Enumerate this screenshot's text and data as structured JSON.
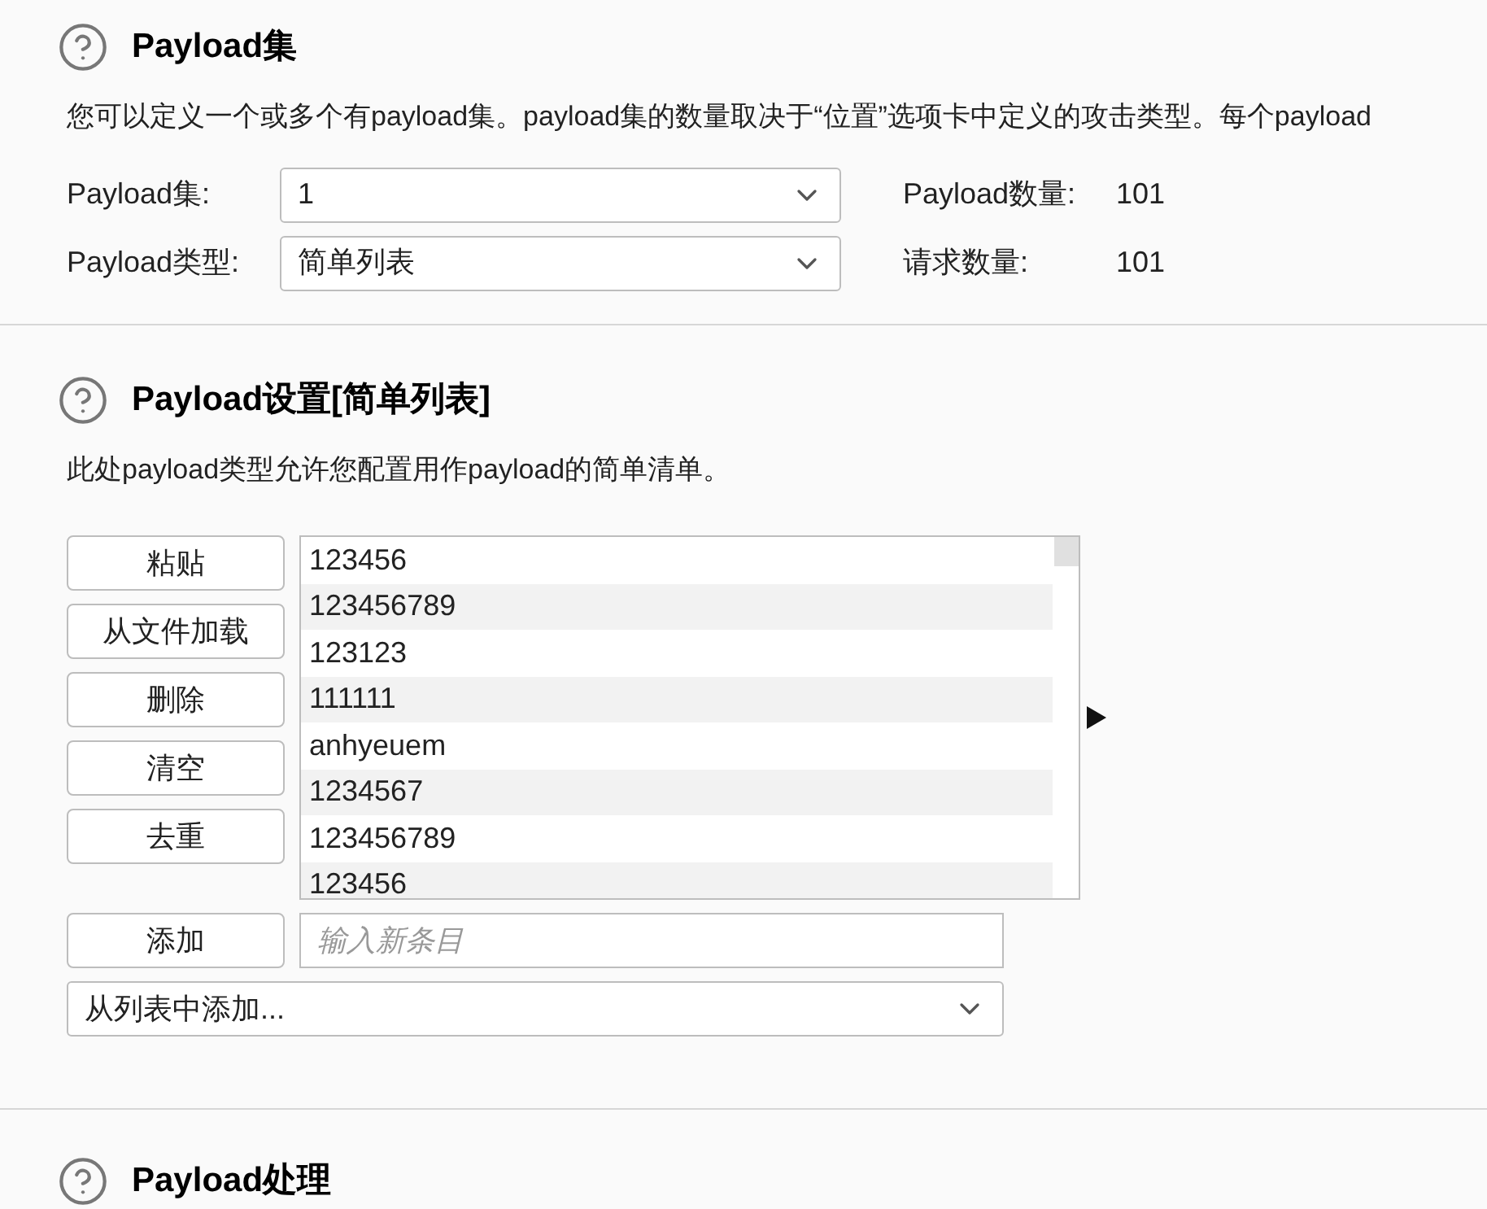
{
  "sections": [
    {
      "title": "Payload集",
      "description": "您可以定义一个或多个有payload集。payload集的数量取决于“位置”选项卡中定义的攻击类型。每个payload",
      "fields": [
        {
          "label": "Payload集:",
          "value": "1",
          "stat_label": "Payload数量:",
          "stat_value": "101"
        },
        {
          "label": "Payload类型:",
          "value": "简单列表",
          "stat_label": "请求数量:",
          "stat_value": "101"
        }
      ]
    },
    {
      "title": "Payload设置[简单列表]",
      "description": "此处payload类型允许您配置用作payload的简单清单。",
      "buttons": [
        "粘贴",
        "从文件加载",
        "删除",
        "清空",
        "去重"
      ],
      "items": [
        "123456",
        "123456789",
        "123123",
        "111111",
        "anhyeuem",
        "1234567",
        "123456789",
        "123456"
      ],
      "add_button": "添加",
      "add_placeholder": "输入新条目",
      "list_select": "从列表中添加..."
    },
    {
      "title": "Payload处理"
    }
  ]
}
